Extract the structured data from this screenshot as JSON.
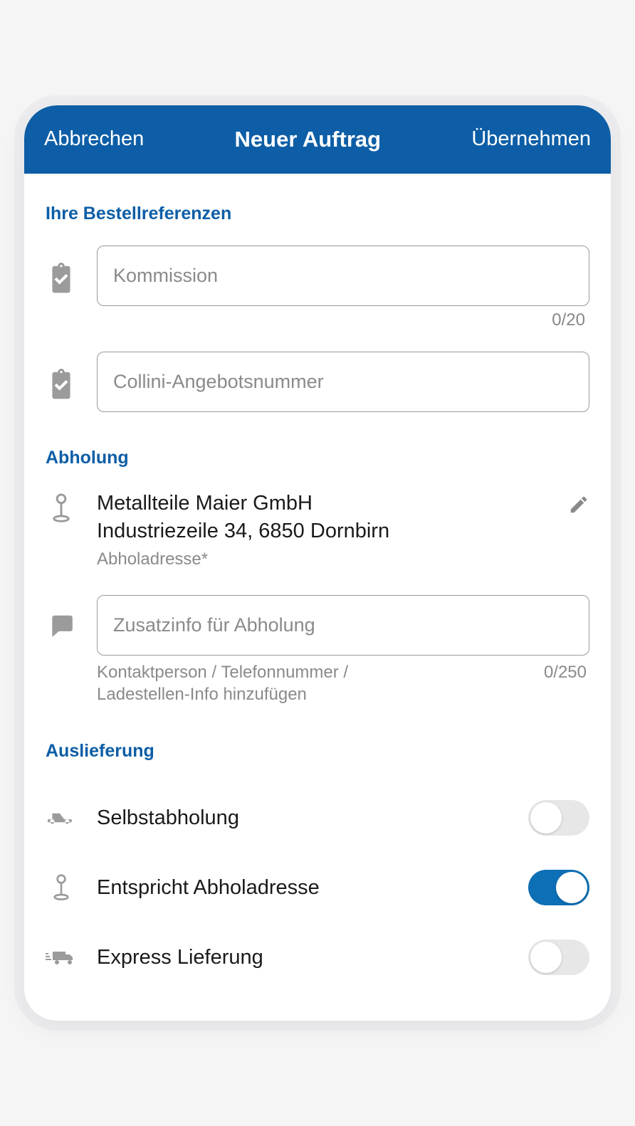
{
  "header": {
    "cancel": "Abbrechen",
    "title": "Neuer Auftrag",
    "apply": "Übernehmen"
  },
  "colors": {
    "primary": "#0d5ea6"
  },
  "refs": {
    "title": "Ihre Bestellreferenzen",
    "kommission": {
      "value": "",
      "placeholder": "Kommission",
      "counter": "0/20"
    },
    "angebot": {
      "value": "",
      "placeholder": "Collini-Angebotsnummer"
    }
  },
  "pickup": {
    "title": "Abholung",
    "name": "Metallteile Maier GmbH",
    "address": "Industriezeile 34, 6850 Dornbirn",
    "sub": "Abholadresse*",
    "note": {
      "value": "",
      "placeholder": "Zusatzinfo für Abholung",
      "hint": "Kontaktperson / Telefonnummer / Ladestellen-Info hinzufügen",
      "counter": "0/250"
    }
  },
  "delivery": {
    "title": "Auslieferung",
    "self": {
      "label": "Selbstabholung",
      "on": false
    },
    "same": {
      "label": "Entspricht Abholadresse",
      "on": true
    },
    "express": {
      "label": "Express Lieferung",
      "on": false
    }
  },
  "icons": {
    "clipboard": "clipboard-check-icon",
    "pin": "pin-icon",
    "pencil": "pencil-icon",
    "speech": "speech-bubble-icon",
    "pickup_truck": "pickup-truck-icon",
    "express_truck": "express-truck-icon"
  }
}
